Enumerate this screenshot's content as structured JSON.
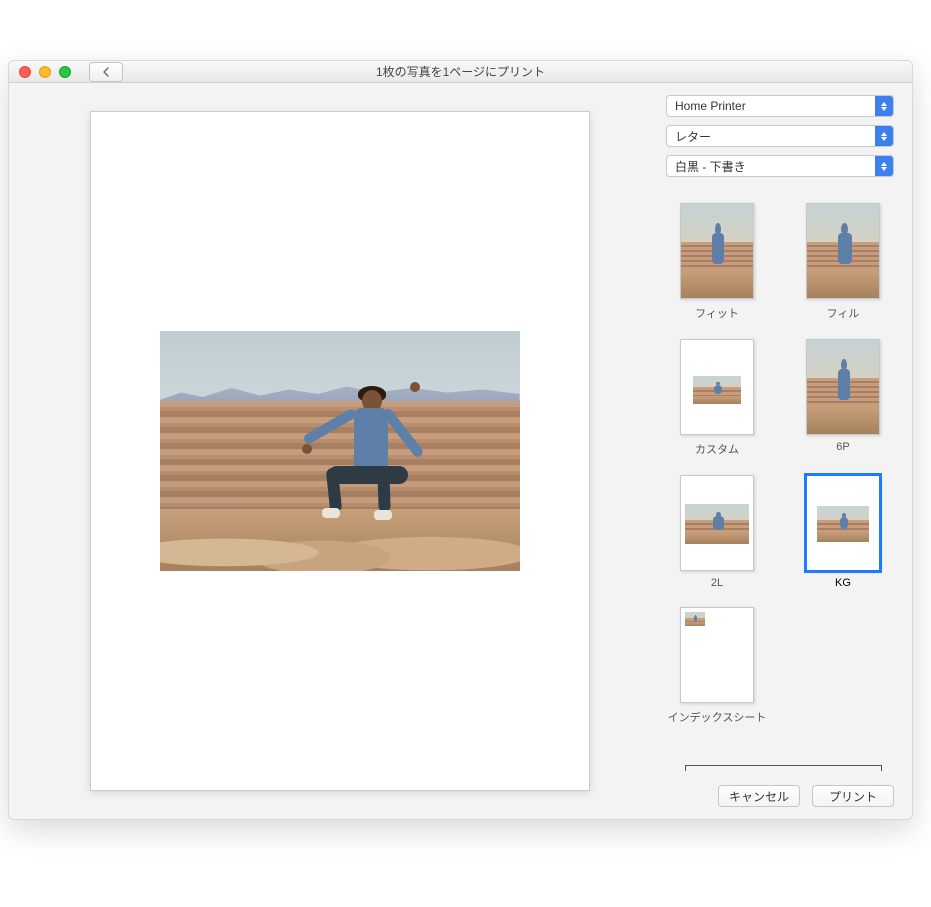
{
  "window": {
    "title": "1枚の写真を1ページにプリント"
  },
  "selects": {
    "printer": "Home Printer",
    "paper": "レター",
    "quality": "白黒 - 下書き"
  },
  "layouts": {
    "fit": {
      "label": "フィット"
    },
    "fill": {
      "label": "フィル"
    },
    "custom": {
      "label": "カスタム"
    },
    "sixp": {
      "label": "6P"
    },
    "twol": {
      "label": "2L"
    },
    "kg": {
      "label": "KG"
    },
    "index": {
      "label": "インデックスシート"
    }
  },
  "buttons": {
    "cancel": "キャンセル",
    "print": "プリント"
  }
}
